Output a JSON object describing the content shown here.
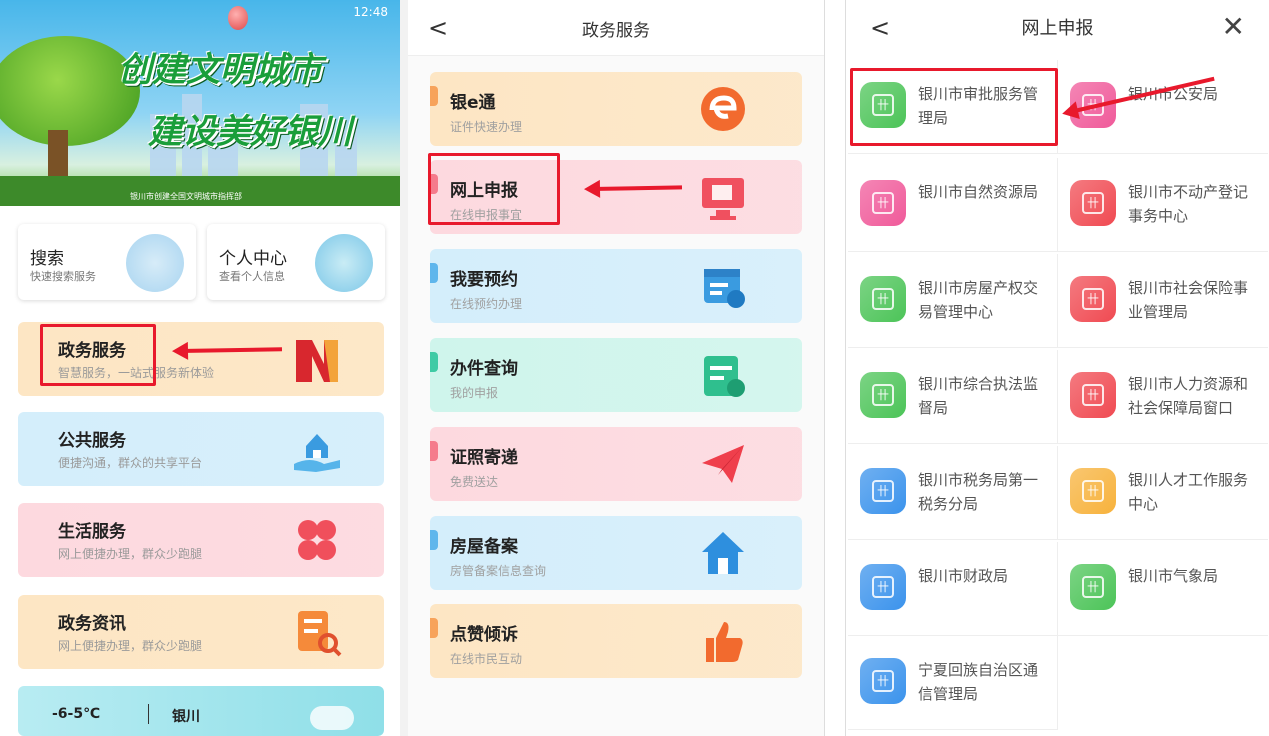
{
  "panel1": {
    "status_left": "",
    "status_time": "12:48",
    "banner_line1": "创建文明城市",
    "banner_line2": "建设美好银川",
    "banner_caption": "银川市创建全国文明城市指挥部",
    "search": {
      "title": "搜索",
      "subtitle": "快速搜索服务"
    },
    "profile": {
      "title": "个人中心",
      "subtitle": "查看个人信息"
    },
    "services": [
      {
        "title": "政务服务",
        "subtitle": "智慧服务，一站式服务新体验",
        "color": "#fde6c4"
      },
      {
        "title": "公共服务",
        "subtitle": "便捷沟通，群众的共享平台",
        "color": "#d4eefb"
      },
      {
        "title": "生活服务",
        "subtitle": "网上便捷办理，群众少跑腿",
        "color": "#fdd9df"
      },
      {
        "title": "政务资讯",
        "subtitle": "网上便捷办理，群众少跑腿",
        "color": "#fde6c4"
      }
    ],
    "weather": {
      "temp": "-6-5℃",
      "city": "银川"
    }
  },
  "panel2": {
    "title": "政务服务",
    "items": [
      {
        "title": "银e通",
        "subtitle": "证件快速办理",
        "color": "#fde6c4",
        "accent": "#f7a35b"
      },
      {
        "title": "网上申报",
        "subtitle": "在线申报事宜",
        "color": "#fdd9df",
        "accent": "#f57b8c"
      },
      {
        "title": "我要预约",
        "subtitle": "在线预约办理",
        "color": "#d4eefb",
        "accent": "#5fb6ec"
      },
      {
        "title": "办件查询",
        "subtitle": "我的申报",
        "color": "#cff5ec",
        "accent": "#3fcba5"
      },
      {
        "title": "证照寄递",
        "subtitle": "免费送达",
        "color": "#fdd9df",
        "accent": "#f57b8c"
      },
      {
        "title": "房屋备案",
        "subtitle": "房管备案信息查询",
        "color": "#d4eefb",
        "accent": "#5fb6ec"
      },
      {
        "title": "点赞倾诉",
        "subtitle": "在线市民互动",
        "color": "#fde6c4",
        "accent": "#f7a35b"
      }
    ]
  },
  "panel3": {
    "title": "网上申报",
    "departments": [
      {
        "name": "银川市审批服务管理局",
        "color": "#4cc458"
      },
      {
        "name": "银川市公安局",
        "color": "#f05a9a"
      },
      {
        "name": "银川市自然资源局",
        "color": "#f05a9a"
      },
      {
        "name": "银川市不动产登记事务中心",
        "color": "#f04a52"
      },
      {
        "name": "银川市房屋产权交易管理中心",
        "color": "#4cc458"
      },
      {
        "name": "银川市社会保险事业管理局",
        "color": "#f04a52"
      },
      {
        "name": "银川市综合执法监督局",
        "color": "#4cc458"
      },
      {
        "name": "银川市人力资源和社会保障局窗口",
        "color": "#f04a52"
      },
      {
        "name": "银川市税务局第一税务分局",
        "color": "#3b93ec"
      },
      {
        "name": "银川人才工作服务中心",
        "color": "#f7b23c"
      },
      {
        "name": "银川市财政局",
        "color": "#3b93ec"
      },
      {
        "name": "银川市气象局",
        "color": "#4cc458"
      },
      {
        "name": "宁夏回族自治区通信管理局",
        "color": "#3b93ec"
      }
    ]
  },
  "annotation_color": "#e8192c"
}
